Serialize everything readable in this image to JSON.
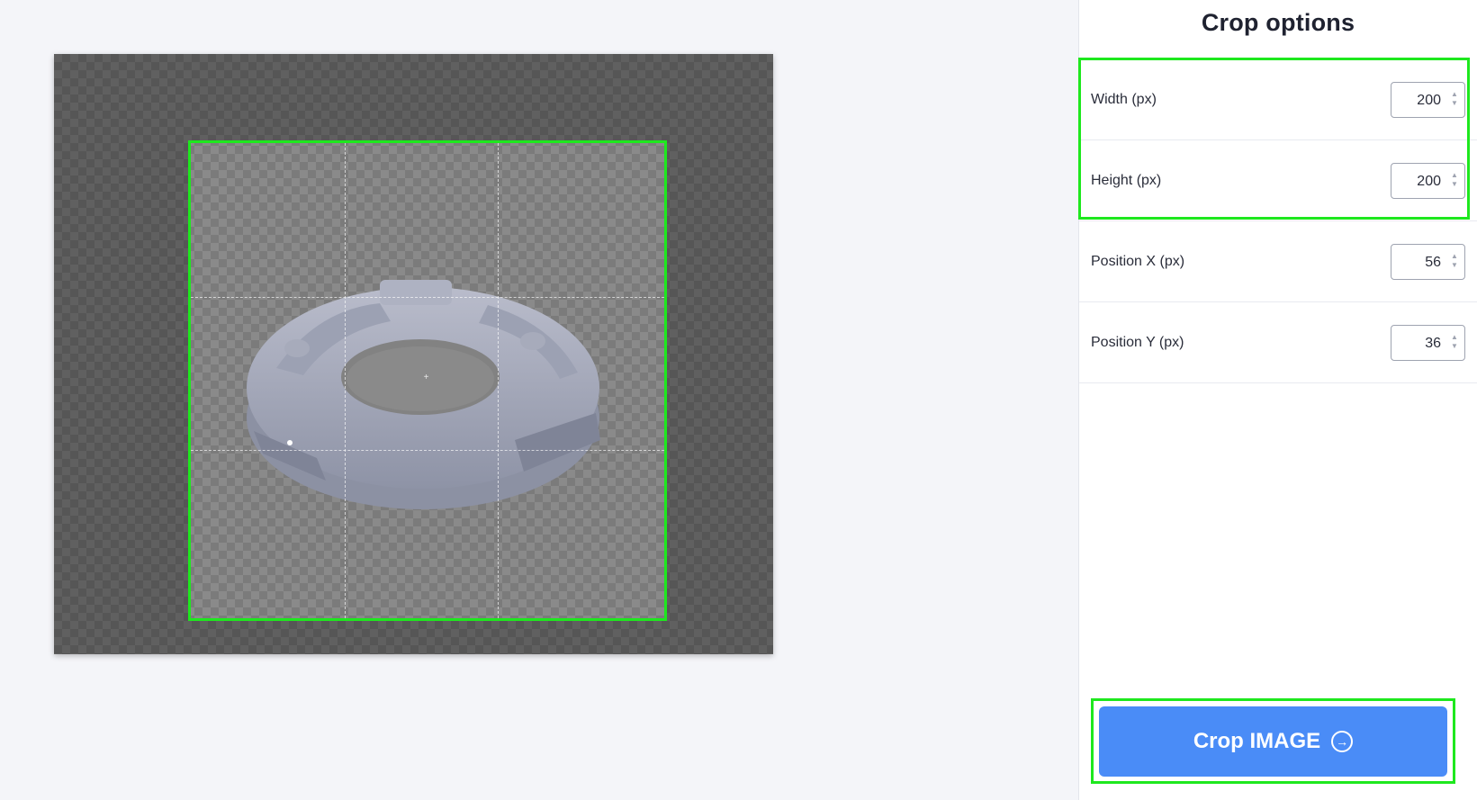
{
  "panel": {
    "title": "Crop options",
    "fields": [
      {
        "label": "Width (px)",
        "value": "200"
      },
      {
        "label": "Height (px)",
        "value": "200"
      },
      {
        "label": "Position X (px)",
        "value": "56"
      },
      {
        "label": "Position Y (px)",
        "value": "36"
      }
    ],
    "crop_button_label": "Crop IMAGE"
  },
  "icons": {
    "crop_button_icon": "arrow-right-circle-icon",
    "spinner_icon": "spinner-arrows-icon"
  },
  "colors": {
    "accent": "#4a8cf7",
    "highlight": "#1ee81e",
    "checker_dark": "#6c6c6c"
  }
}
